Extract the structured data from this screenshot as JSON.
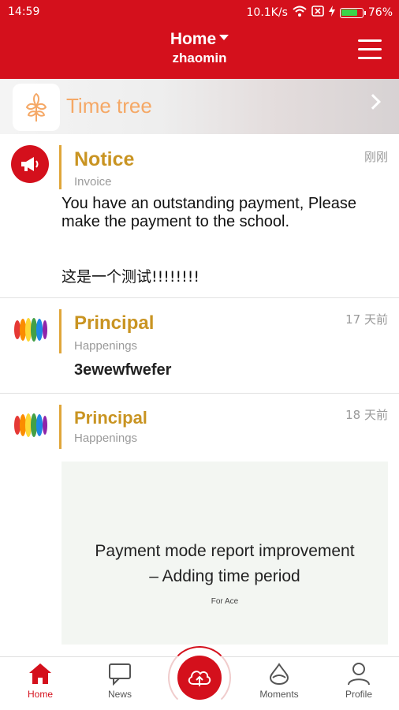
{
  "status_bar": {
    "time": "14:59",
    "speed": "10.1K/s",
    "battery": "76%"
  },
  "header": {
    "title": "Home",
    "subtitle": "zhaomin",
    "menu_icon": "hamburger-icon"
  },
  "banner": {
    "label": "Time tree",
    "icon": "tree-icon"
  },
  "feed": [
    {
      "title": "Notice",
      "subtitle": "Invoice",
      "time": "刚刚",
      "body": "You have an outstanding payment, Please make the payment to the school.",
      "body_extra": "这是一个测试!!!!!!!!",
      "icon": "megaphone-icon"
    },
    {
      "title": "Principal",
      "subtitle": "Happenings",
      "time": "17 天前",
      "body": "3ewewfwefer",
      "icon": "colorful-logo-icon"
    },
    {
      "title": "Principal",
      "subtitle": "Happenings",
      "time": "18 天前",
      "image_text_1": "Payment mode report improvement",
      "image_text_2": "– Adding time period",
      "image_text_3": "For Ace",
      "icon": "colorful-logo-icon"
    }
  ],
  "bottom_nav": [
    {
      "label": "Home",
      "icon": "home-icon",
      "active": true
    },
    {
      "label": "News",
      "icon": "chat-icon"
    },
    {
      "label": "",
      "icon": "upload-cloud-icon"
    },
    {
      "label": "Moments",
      "icon": "moments-icon"
    },
    {
      "label": "Profile",
      "icon": "profile-icon"
    }
  ],
  "colors": {
    "primary_red": "#d4101c",
    "accent_gold": "#c99422",
    "banner_orange": "#f5a866"
  }
}
